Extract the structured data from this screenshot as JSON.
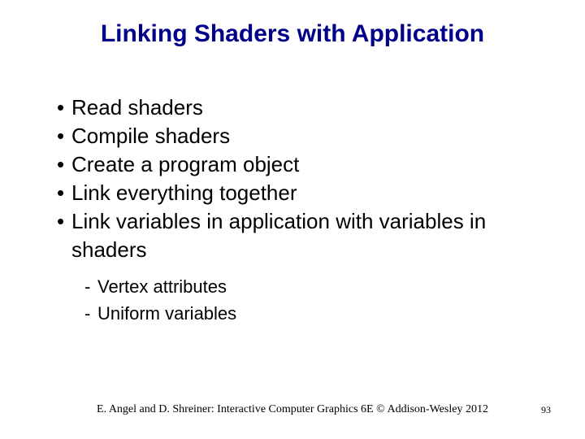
{
  "title": "Linking Shaders with Application",
  "bullets": [
    "Read shaders",
    "Compile shaders",
    "Create a program object",
    "Link everything together",
    "Link variables in application with variables in shaders"
  ],
  "subbullets": [
    "Vertex attributes",
    "Uniform variables"
  ],
  "footer": "E. Angel and D. Shreiner: Interactive Computer Graphics 6E © Addison-Wesley 2012",
  "page": "93"
}
